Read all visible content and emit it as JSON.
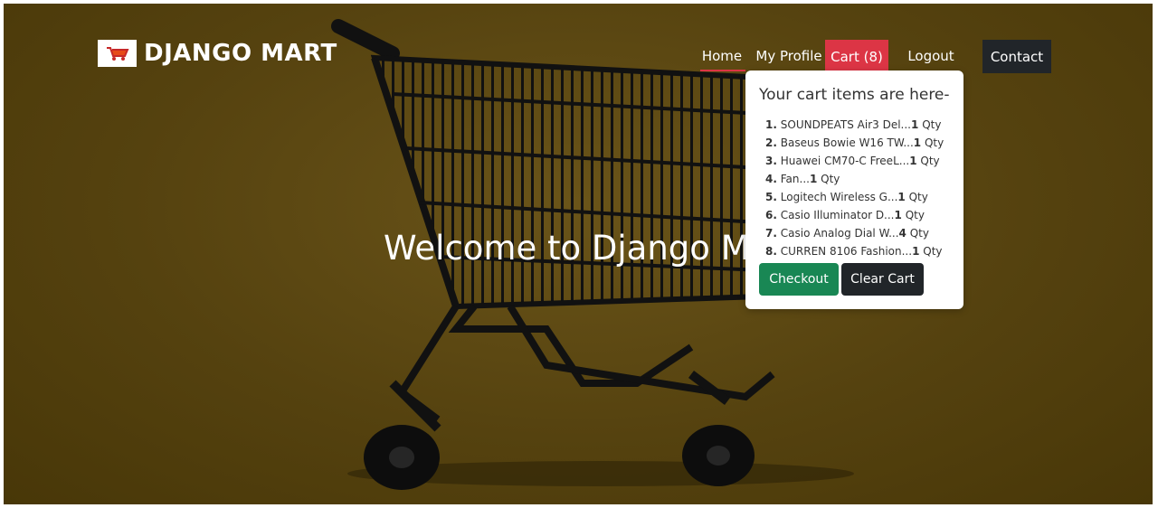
{
  "brand": {
    "name": "DJANGO MART",
    "logo_icon": "shopping-cart-logo-icon"
  },
  "nav": {
    "home": "Home",
    "profile": "My Profile",
    "cart": "Cart (8)",
    "logout": "Logout",
    "contact": "Contact"
  },
  "hero": {
    "heading": "Welcome to Django Ma"
  },
  "cart_popover": {
    "title": "Your cart items are here-",
    "items": [
      {
        "num": "1.",
        "name": "SOUNDPEATS Air3 Del...",
        "qty": "1",
        "unit": "Qty"
      },
      {
        "num": "2.",
        "name": "Baseus Bowie W16 TW...",
        "qty": "1",
        "unit": "Qty"
      },
      {
        "num": "3.",
        "name": "Huawei CM70-C FreeL...",
        "qty": "1",
        "unit": "Qty"
      },
      {
        "num": "4.",
        "name": "Fan...",
        "qty": "1",
        "unit": "Qty"
      },
      {
        "num": "5.",
        "name": "Logitech Wireless G...",
        "qty": "1",
        "unit": "Qty"
      },
      {
        "num": "6.",
        "name": "Casio Illuminator D...",
        "qty": "1",
        "unit": "Qty"
      },
      {
        "num": "7.",
        "name": "Casio Analog Dial W...",
        "qty": "4",
        "unit": "Qty"
      },
      {
        "num": "8.",
        "name": "CURREN 8106 Fashion...",
        "qty": "1",
        "unit": "Qty"
      }
    ],
    "checkout_label": "Checkout",
    "clear_label": "Clear Cart"
  },
  "colors": {
    "hero_bg": "#55420f",
    "accent_red": "#dc3545",
    "dark": "#212529",
    "success": "#198754"
  }
}
